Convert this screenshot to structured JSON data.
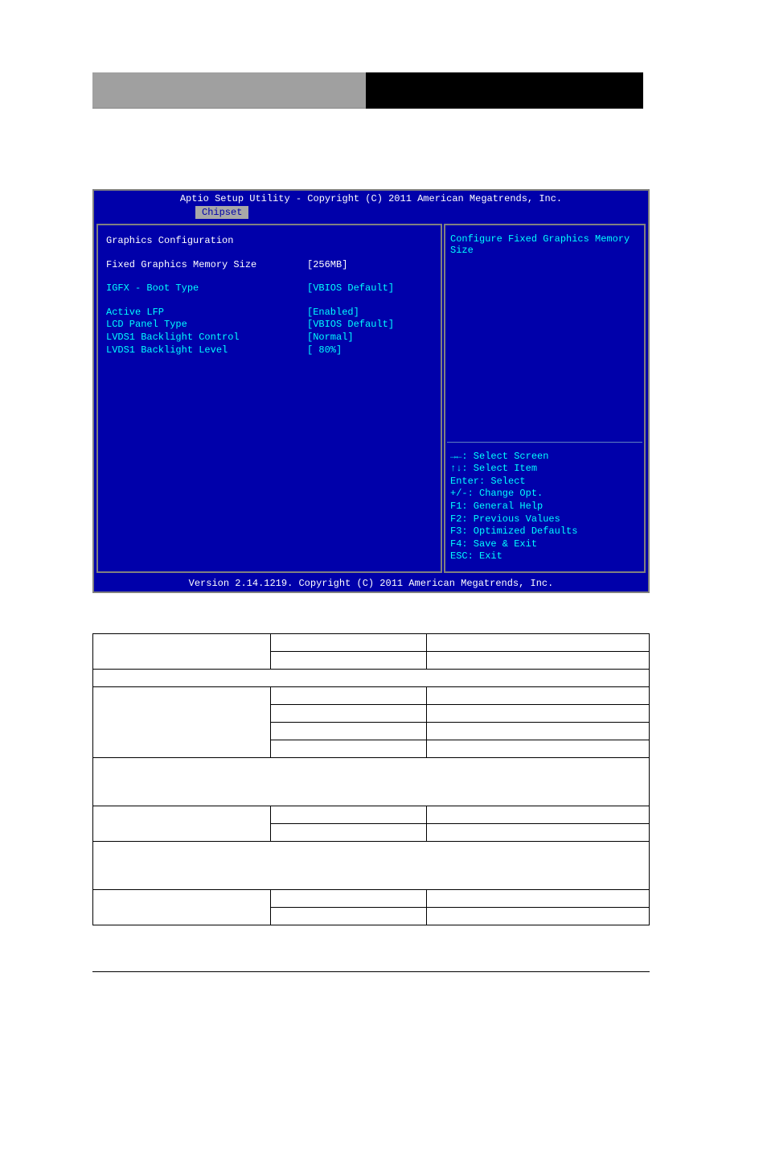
{
  "bios": {
    "title": "Aptio Setup Utility - Copyright (C) 2011 American Megatrends, Inc.",
    "tab": "Chipset",
    "section_title": "Graphics Configuration",
    "settings": [
      {
        "label": "Fixed Graphics Memory Size",
        "value": "[256MB]"
      },
      {
        "label": "IGFX - Boot Type",
        "value": "[VBIOS Default]"
      },
      {
        "label": "Active LFP",
        "value": "[Enabled]"
      },
      {
        "label": "LCD Panel Type",
        "value": "[VBIOS Default]"
      },
      {
        "label": "LVDS1 Backlight Control",
        "value": "[Normal]"
      },
      {
        "label": "LVDS1 Backlight Level",
        "value": "[ 80%]"
      }
    ],
    "help_text": "Configure Fixed Graphics Memory Size",
    "keys": [
      "→←: Select Screen",
      "↑↓: Select Item",
      "Enter: Select",
      "+/-: Change Opt.",
      "F1: General Help",
      "F2: Previous Values",
      "F3: Optimized Defaults",
      "F4: Save & Exit",
      "ESC: Exit"
    ],
    "footer": "Version 2.14.1219. Copyright (C) 2011 American Megatrends, Inc."
  }
}
